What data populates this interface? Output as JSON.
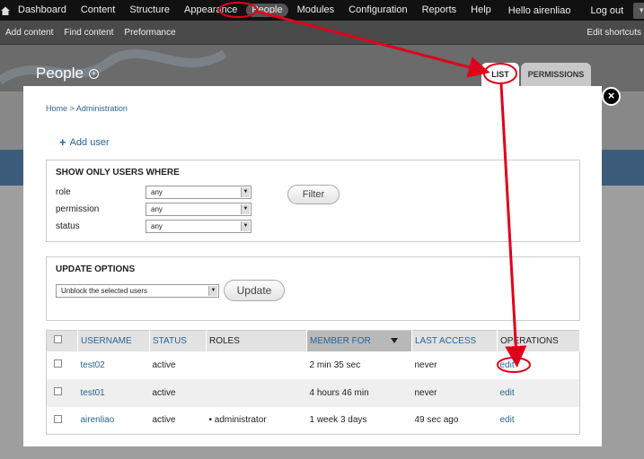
{
  "toolbar": {
    "menu": [
      "Dashboard",
      "Content",
      "Structure",
      "Appearance",
      "People",
      "Modules",
      "Configuration",
      "Reports",
      "Help"
    ],
    "active_item": "People",
    "greeting": "Hello airenliao",
    "logout": "Log out"
  },
  "shortcuts": {
    "items": [
      "Add content",
      "Find content",
      "Preformance"
    ],
    "edit_shortcuts": "Edit shortcuts"
  },
  "page": {
    "title": "People",
    "tabs": [
      "LIST",
      "PERMISSIONS"
    ]
  },
  "overlay": {
    "breadcrumb": [
      "Home",
      "Administration"
    ],
    "breadcrumb_sep": ">",
    "add_user": "Add user",
    "filter": {
      "legend": "SHOW ONLY USERS WHERE",
      "rows": [
        {
          "label": "role",
          "value": "any"
        },
        {
          "label": "permission",
          "value": "any"
        },
        {
          "label": "status",
          "value": "any"
        }
      ],
      "button": "Filter"
    },
    "update": {
      "legend": "UPDATE OPTIONS",
      "select_value": "Unblock the selected users",
      "button": "Update"
    },
    "table": {
      "columns": [
        "USERNAME",
        "STATUS",
        "ROLES",
        "MEMBER FOR",
        "LAST ACCESS",
        "OPERATIONS"
      ],
      "rows": [
        {
          "username": "test02",
          "status": "active",
          "roles": "",
          "member_for": "2 min 35 sec",
          "last_access": "never",
          "operation": "edit"
        },
        {
          "username": "test01",
          "status": "active",
          "roles": "",
          "member_for": "4 hours 46 min",
          "last_access": "never",
          "operation": "edit"
        },
        {
          "username": "airenliao",
          "status": "active",
          "roles": "administrator",
          "member_for": "1 week 3 days",
          "last_access": "49 sec ago",
          "operation": "edit"
        }
      ]
    }
  },
  "colors": {
    "link": "#2a6496",
    "annotation": "#e0001b",
    "toolbar": "#111111"
  }
}
